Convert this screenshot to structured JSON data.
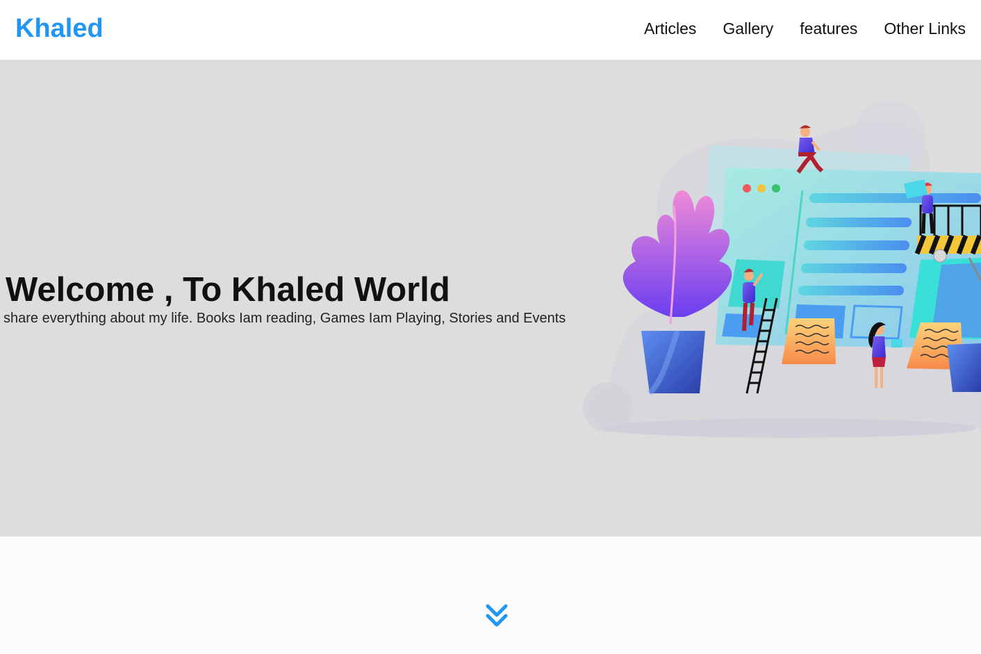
{
  "header": {
    "logo": "Khaled",
    "nav": [
      {
        "label": "Articles"
      },
      {
        "label": "Gallery"
      },
      {
        "label": "features"
      },
      {
        "label": "Other Links"
      }
    ]
  },
  "landing": {
    "title": "Welcome , To Khaled World",
    "text": "share everything about my life. Books Iam reading, Games Iam Playing, Stories and Events",
    "illustration_icon": "website-building-illustration"
  },
  "go_down": {
    "icon": "double-chevron-down-icon"
  },
  "colors": {
    "accent": "#2196f3",
    "landing_bg": "#dddddd",
    "header_bg": "#ffffff",
    "page_bg": "#fcfcfc"
  }
}
